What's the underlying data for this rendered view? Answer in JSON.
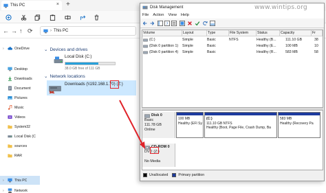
{
  "explorer": {
    "tab_title": "This PC",
    "tab_add": "+",
    "tab_close": "×",
    "address_path": "This PC",
    "address_sep": "›",
    "nav_back": "←",
    "nav_forward": "→",
    "nav_up": "↑",
    "nav_refresh": "⟳",
    "groups": {
      "devices": "Devices and drives",
      "network": "Network locations"
    },
    "drive": {
      "name": "Local Disk (C:)",
      "free_text": "38.0 GB free of 111 GB",
      "used_fraction": 0.66
    },
    "network_drive": {
      "label": "Downloads (\\\\192.168.1.70) (Z:)"
    },
    "sidebar": [
      {
        "label": "OneDrive",
        "icon": "cloud-icon"
      },
      {
        "label": "Desktop",
        "icon": "desktop-icon"
      },
      {
        "label": "Downloads",
        "icon": "download-icon"
      },
      {
        "label": "Document",
        "icon": "document-icon"
      },
      {
        "label": "Pictures",
        "icon": "pictures-icon"
      },
      {
        "label": "Music",
        "icon": "music-icon"
      },
      {
        "label": "Videos",
        "icon": "videos-icon"
      },
      {
        "label": "System32",
        "icon": "folder-icon"
      },
      {
        "label": "Local Disk (C",
        "icon": "drive-icon"
      },
      {
        "label": "sources",
        "icon": "folder-icon"
      },
      {
        "label": "RAR",
        "icon": "folder-icon"
      },
      {
        "label": "This PC",
        "icon": "pc-icon",
        "active": true
      },
      {
        "label": "Network",
        "icon": "network-icon"
      }
    ]
  },
  "disk_management": {
    "title": "Disk Management",
    "menu": [
      "File",
      "Action",
      "View",
      "Help"
    ],
    "columns": [
      "Volume",
      "Layout",
      "Type",
      "File System",
      "Status",
      "Capacity",
      "Fr"
    ],
    "rows": [
      {
        "volume": "(C:)",
        "layout": "Simple",
        "type": "Basic",
        "fs": "NTFS",
        "status": "Healthy (B...",
        "capacity": "111.10 GB",
        "free": "38"
      },
      {
        "volume": "(Disk 0 partition 1)",
        "layout": "Simple",
        "type": "Basic",
        "fs": "",
        "status": "Healthy (E...",
        "capacity": "100 MB",
        "free": "10"
      },
      {
        "volume": "(Disk 0 partition 4)",
        "layout": "Simple",
        "type": "Basic",
        "fs": "",
        "status": "Healthy (R...",
        "capacity": "583 MB",
        "free": "58"
      }
    ],
    "disk0": {
      "name": "Disk 0",
      "type": "Basic",
      "size": "111.78 GB",
      "status": "Online",
      "partitions": [
        {
          "line1": "100 MB",
          "line2": "Healthy (EFI Sy"
        },
        {
          "line1": "(C:)",
          "line2": "111.10 GB NTFS",
          "line3": "Healthy (Boot, Page File, Crash Dump, Ba"
        },
        {
          "line1": "583 MB",
          "line2": "Healthy (Recovery Pa"
        }
      ]
    },
    "cdrom0": {
      "name": "CD-ROM 0",
      "type_prefix": "DVD",
      "letter": "(Z:)",
      "status": "No Media"
    },
    "legend": [
      {
        "label": "Unallocated",
        "color": "#000000"
      },
      {
        "label": "Primary partition",
        "color": "#1c3a9e"
      }
    ]
  },
  "watermark": "www.wintips.org",
  "colors": {
    "accent": "#26a0da",
    "selection": "#cce8ff",
    "highlight_red": "#e0232a",
    "partition_stripe": "#1c3a9e"
  }
}
